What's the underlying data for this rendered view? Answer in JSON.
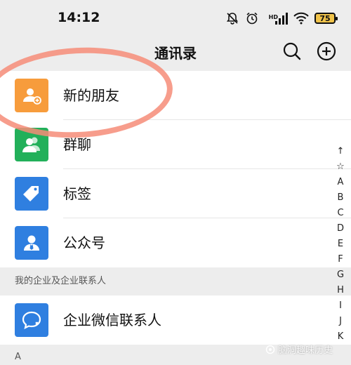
{
  "status_bar": {
    "time": "14:12",
    "network_label": "HD",
    "battery_level": "75",
    "icons": [
      "mute-bell-icon",
      "alarm-icon",
      "signal-icon",
      "wifi-icon",
      "battery-icon"
    ]
  },
  "nav": {
    "title": "通讯录",
    "icons": [
      "search-icon",
      "add-circle-icon"
    ]
  },
  "entries": [
    {
      "label": "新的朋友",
      "icon": "new-friend-icon",
      "color": "#f79c3c"
    },
    {
      "label": "群聊",
      "icon": "group-chat-icon",
      "color": "#22b05a"
    },
    {
      "label": "标签",
      "icon": "tag-icon",
      "color": "#2f7fe0"
    },
    {
      "label": "公众号",
      "icon": "official-account-icon",
      "color": "#2f7fe0"
    }
  ],
  "enterprise_section": {
    "header": "我的企业及企业联系人",
    "entries": [
      {
        "label": "企业微信联系人",
        "icon": "wecom-contacts-icon",
        "color": "#2f7fe0"
      }
    ]
  },
  "contacts_section_header": "A",
  "index_bar": [
    "↑",
    "☆",
    "A",
    "B",
    "C",
    "D",
    "E",
    "F",
    "G",
    "H",
    "I",
    "J",
    "K"
  ],
  "watermark": "脑洞趣味历史",
  "colors": {
    "background": "#ededed",
    "annotation": "#f68c78"
  }
}
